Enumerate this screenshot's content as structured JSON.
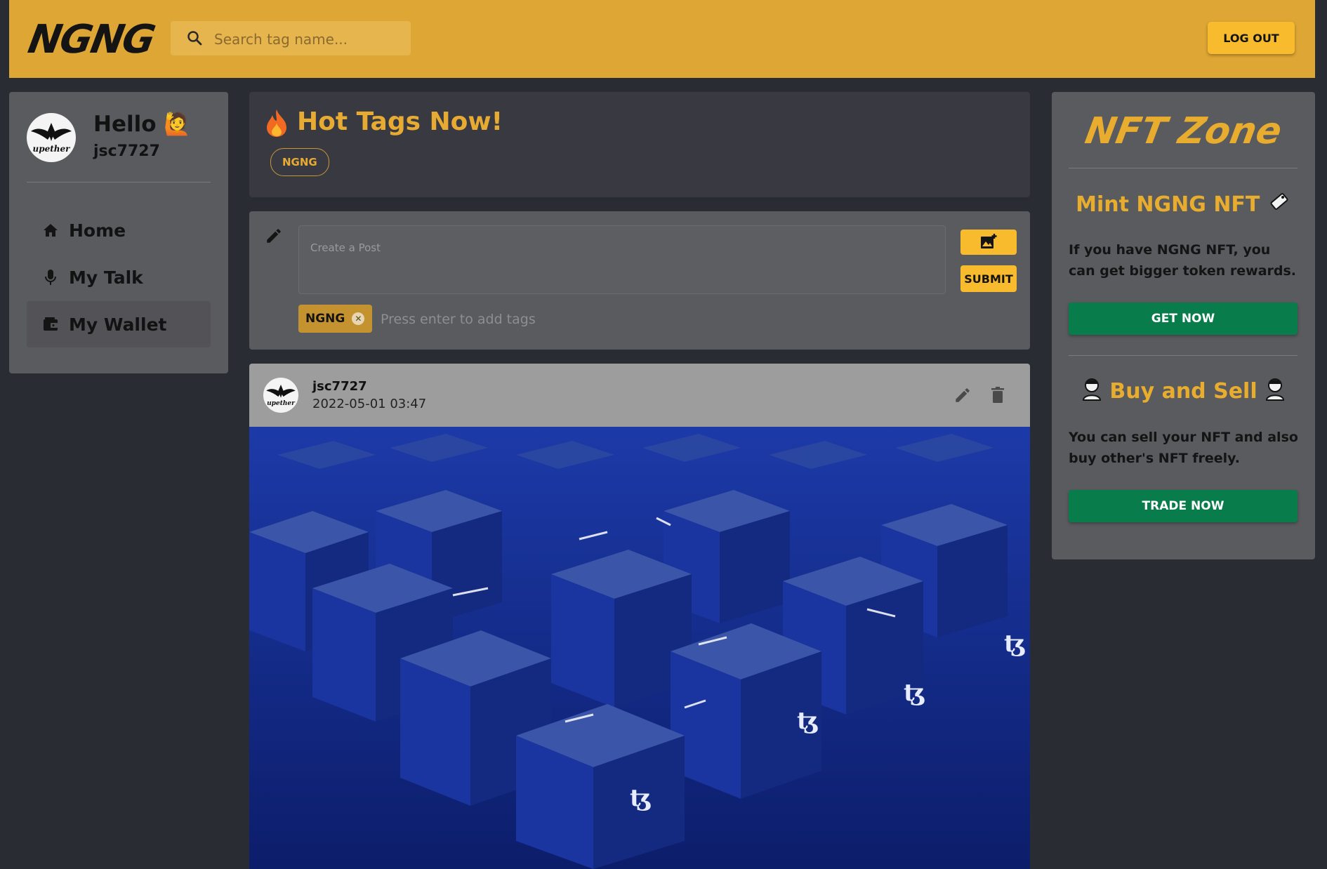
{
  "header": {
    "logo": "NGNG",
    "search_placeholder": "Search tag name...",
    "logout_label": "LOG OUT"
  },
  "sidebar": {
    "greeting": "Hello 🙋",
    "username": "jsc7727",
    "avatar_brand": "upether",
    "items": [
      {
        "label": "Home",
        "icon": "home-icon"
      },
      {
        "label": "My Talk",
        "icon": "microphone-icon"
      },
      {
        "label": "My Wallet",
        "icon": "wallet-icon",
        "active": true
      }
    ]
  },
  "hot_tags": {
    "title": "Hot Tags Now!",
    "tags": [
      "NGNG"
    ]
  },
  "create_post": {
    "placeholder": "Create a Post",
    "submit_label": "SUBMIT",
    "chip_label": "NGNG",
    "tag_placeholder": "Press enter to add tags"
  },
  "post": {
    "author": "jsc7727",
    "date": "2022-05-01 03:47",
    "avatar_brand": "upether"
  },
  "nft_zone": {
    "title": "NFT Zone",
    "mint_title": "Mint NGNG NFT",
    "mint_text": "If you have NGNG NFT, you can get bigger token rewards.",
    "get_now_label": "GET NOW",
    "trade_title": "Buy and Sell",
    "trade_text": "You can sell your NFT and also buy other's NFT freely.",
    "trade_now_label": "TRADE NOW"
  },
  "colors": {
    "accent": "#dea634",
    "button_yellow": "#f7bb2d",
    "green": "#087c4a",
    "background": "#2a2c33"
  }
}
